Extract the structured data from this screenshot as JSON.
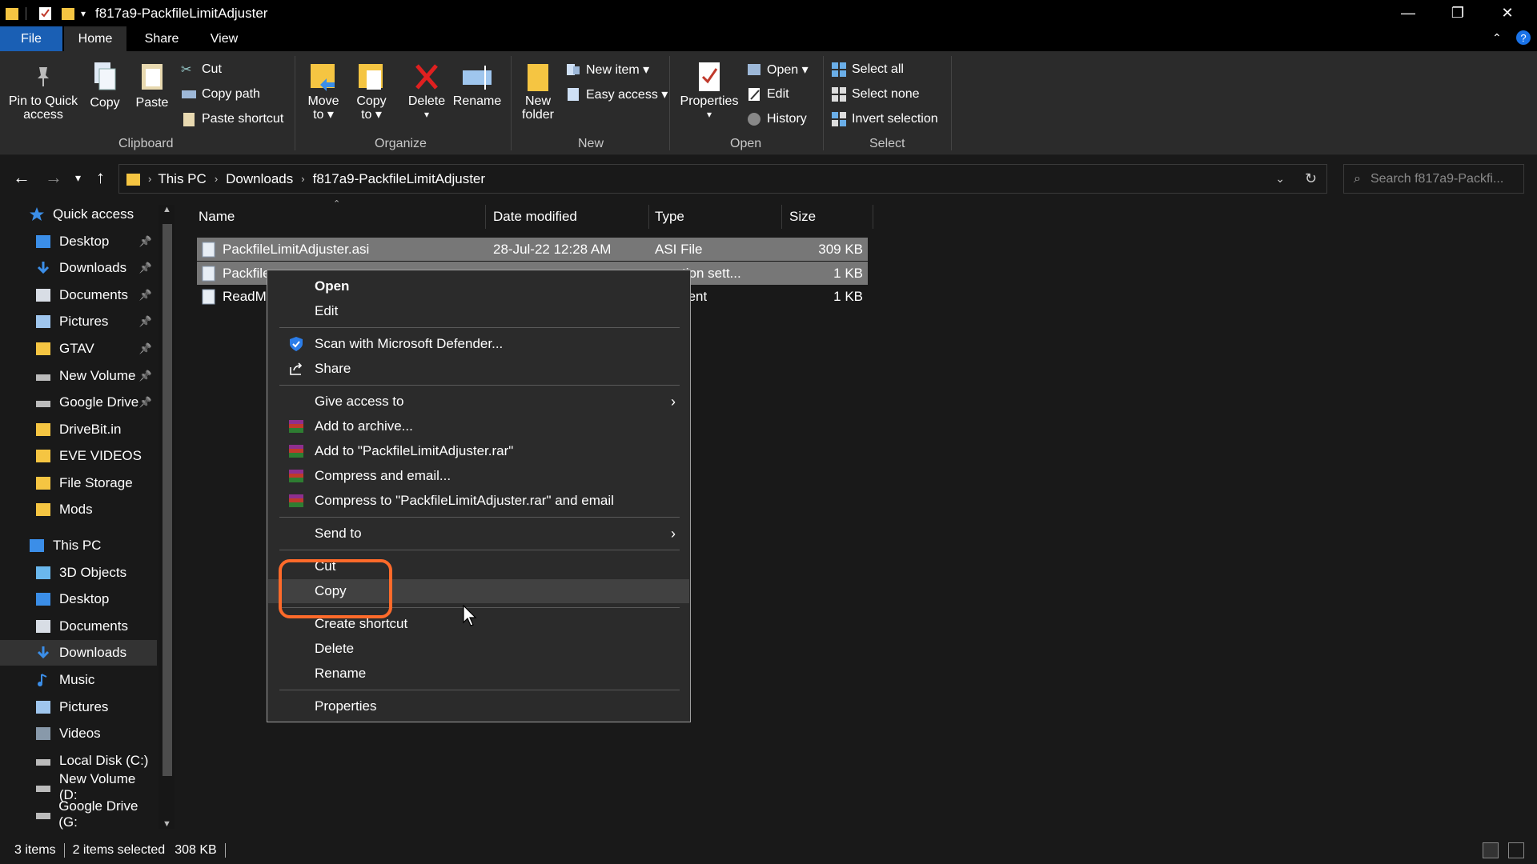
{
  "window": {
    "title": "f817a9-PackfileLimitAdjuster",
    "minimize": "—",
    "restore": "❐",
    "close": "✕"
  },
  "ribbon_tabs": [
    "File",
    "Home",
    "Share",
    "View"
  ],
  "ribbon": {
    "clipboard": {
      "label": "Clipboard",
      "pin": "Pin to Quick access",
      "pin_l1": "Pin to Quick",
      "pin_l2": "access",
      "copy": "Copy",
      "paste": "Paste",
      "cut": "Cut",
      "copy_path": "Copy path",
      "paste_shortcut": "Paste shortcut"
    },
    "organize": {
      "label": "Organize",
      "move_l1": "Move",
      "move_l2": "to ▾",
      "copy_l1": "Copy",
      "copy_l2": "to ▾",
      "delete": "Delete",
      "delete_l2": "▾",
      "rename": "Rename"
    },
    "new": {
      "label": "New",
      "new_folder_l1": "New",
      "new_folder_l2": "folder",
      "new_item": "New item ▾",
      "easy_access": "Easy access ▾"
    },
    "open": {
      "label": "Open",
      "properties": "Properties",
      "properties_l2": "▾",
      "open": "Open ▾",
      "edit": "Edit",
      "history": "History"
    },
    "select": {
      "label": "Select",
      "select_all": "Select all",
      "select_none": "Select none",
      "invert": "Invert selection"
    }
  },
  "address": {
    "crumbs": [
      "This PC",
      "Downloads",
      "f817a9-PackfileLimitAdjuster"
    ],
    "search_placeholder": "Search f817a9-Packfi..."
  },
  "nav": {
    "items": [
      {
        "label": "Quick access",
        "icon": "star-icon",
        "pinned": false
      },
      {
        "label": "Desktop",
        "icon": "desktop-icon",
        "pinned": true
      },
      {
        "label": "Downloads",
        "icon": "download-icon",
        "pinned": true
      },
      {
        "label": "Documents",
        "icon": "documents-icon",
        "pinned": true
      },
      {
        "label": "Pictures",
        "icon": "pictures-icon",
        "pinned": true
      },
      {
        "label": "GTAV",
        "icon": "folder-icon",
        "pinned": true
      },
      {
        "label": "New Volume",
        "icon": "drive-icon",
        "pinned": true
      },
      {
        "label": "Google Drive",
        "icon": "drive-icon",
        "pinned": true
      },
      {
        "label": "DriveBit.in",
        "icon": "folder-icon",
        "pinned": false
      },
      {
        "label": "EVE VIDEOS",
        "icon": "folder-icon",
        "pinned": false
      },
      {
        "label": "File Storage",
        "icon": "folder-icon",
        "pinned": false
      },
      {
        "label": "Mods",
        "icon": "folder-icon",
        "pinned": false
      },
      {
        "label": "This PC",
        "icon": "pc-icon",
        "pinned": false
      },
      {
        "label": "3D Objects",
        "icon": "cube-icon",
        "pinned": false
      },
      {
        "label": "Desktop",
        "icon": "desktop-icon",
        "pinned": false
      },
      {
        "label": "Documents",
        "icon": "documents-icon",
        "pinned": false
      },
      {
        "label": "Downloads",
        "icon": "download-icon",
        "pinned": false
      },
      {
        "label": "Music",
        "icon": "music-icon",
        "pinned": false
      },
      {
        "label": "Pictures",
        "icon": "pictures-icon",
        "pinned": false
      },
      {
        "label": "Videos",
        "icon": "videos-icon",
        "pinned": false
      },
      {
        "label": "Local Disk (C:)",
        "icon": "drive-icon",
        "pinned": false
      },
      {
        "label": "New Volume (D:",
        "icon": "drive-icon",
        "pinned": false
      },
      {
        "label": "Google Drive (G:",
        "icon": "drive-icon",
        "pinned": false
      }
    ],
    "pin_glyph": "📌"
  },
  "columns": {
    "name": "Name",
    "date": "Date modified",
    "type": "Type",
    "size": "Size"
  },
  "files": [
    {
      "name": "PackfileLimitAdjuster.asi",
      "date": "28-Jul-22 12:28 AM",
      "type": "ASI File",
      "size": "309 KB",
      "selected": true
    },
    {
      "name": "Packfile",
      "date": "",
      "type": "guration sett...",
      "size": "1 KB",
      "selected": true
    },
    {
      "name": "ReadMe",
      "date": "",
      "type": "ocument",
      "size": "1 KB",
      "selected": false
    }
  ],
  "context_menu": {
    "open": "Open",
    "edit": "Edit",
    "scan": "Scan with Microsoft Defender...",
    "share": "Share",
    "give_access": "Give access to",
    "add_archive": "Add to archive...",
    "add_rar": "Add to \"PackfileLimitAdjuster.rar\"",
    "compress_email": "Compress and email...",
    "compress_rar_email": "Compress to \"PackfileLimitAdjuster.rar\" and email",
    "send_to": "Send to",
    "cut": "Cut",
    "copy": "Copy",
    "create_shortcut": "Create shortcut",
    "delete": "Delete",
    "rename": "Rename",
    "properties": "Properties",
    "submenu_arrow": "›"
  },
  "status": {
    "items": "3 items",
    "selected": "2 items selected",
    "size": "308 KB"
  },
  "colors": {
    "highlight": "#ff6a2a",
    "file_tab": "#1a5fb4",
    "selection": "#777777"
  }
}
